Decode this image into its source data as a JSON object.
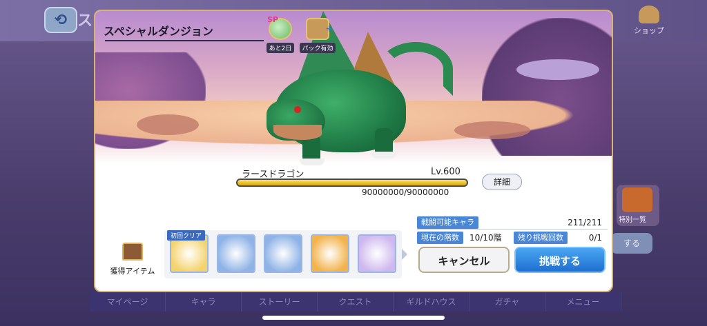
{
  "background": {
    "back_title": "ス",
    "shop_label": "ショップ",
    "side_label": "特別一覧",
    "side_button": "する",
    "nav": [
      "マイページ",
      "キャラ",
      "ストーリー",
      "クエスト",
      "ギルドハウス",
      "ガチャ",
      "メニュー"
    ]
  },
  "modal": {
    "title": "スペシャルダンジョン",
    "sp_badge": {
      "tag": "SP",
      "label": "あと2日"
    },
    "pack_badge": {
      "label": "パック有効"
    },
    "boss": {
      "name": "ラースドラゴン",
      "level": "Lv.600",
      "hp_text": "90000000/90000000",
      "hp_fraction": 1.0
    },
    "detail_button": "詳細",
    "stats": [
      {
        "label": "戦闘可能キャラ",
        "value": "211/211"
      },
      {
        "label": "現在の階数",
        "value": "10/10階"
      },
      {
        "label": "残り挑戦回数",
        "value": "0/1"
      }
    ],
    "rewards": {
      "label": "獲得アイテム",
      "first_clear_tag": "初回クリア",
      "items": [
        {
          "icon": "staff-weapon-icon",
          "color": "#f4d36b"
        },
        {
          "icon": "lion-medal-icon",
          "color": "#8fb3e6"
        },
        {
          "icon": "heart-medal-icon",
          "color": "#8fb3e6"
        },
        {
          "icon": "green-orbs-icon",
          "color": "#f2b34b"
        },
        {
          "icon": "pink-crystal-icon",
          "color": "#cfb8ef"
        }
      ]
    },
    "buttons": {
      "cancel": "キャンセル",
      "challenge": "挑戦する"
    }
  }
}
